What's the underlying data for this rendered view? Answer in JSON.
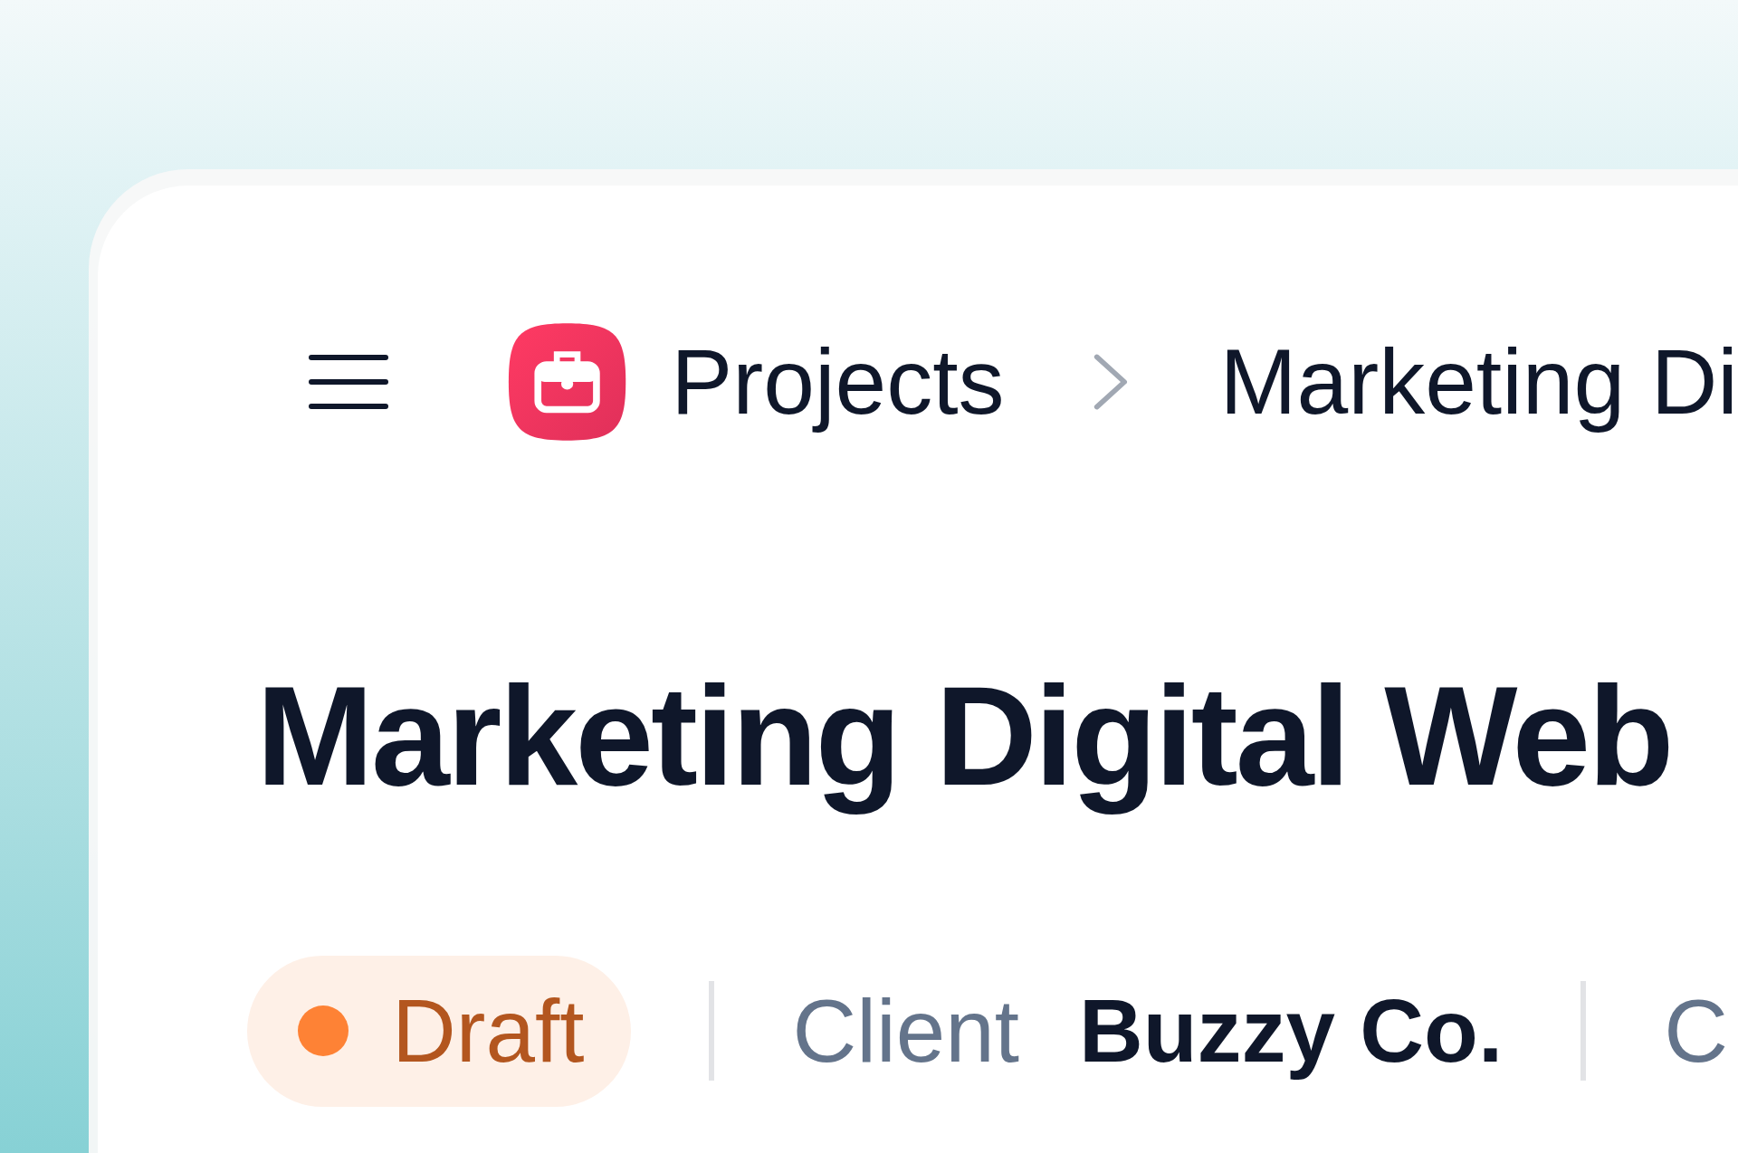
{
  "breadcrumb": [
    {
      "label": "Projects"
    },
    {
      "label": "Marketing Di"
    }
  ],
  "title": "Marketing Digital Web",
  "status": {
    "label": "Draft",
    "kind": "draft"
  },
  "meta": [
    {
      "label": "Client",
      "value": "Buzzy Co."
    },
    {
      "label": "C"
    }
  ]
}
